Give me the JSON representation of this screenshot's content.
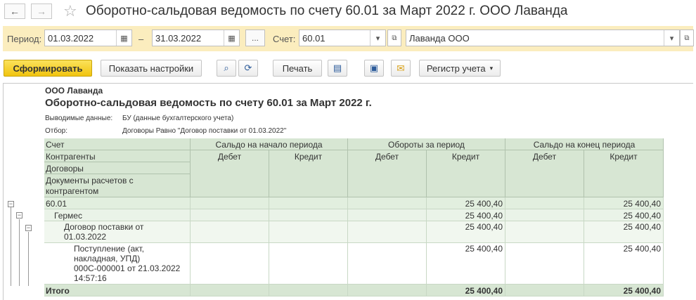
{
  "window": {
    "title": "Оборотно-сальдовая ведомость по счету 60.01 за Март 2022 г. ООО Лаванда",
    "back_icon": "←",
    "forward_icon": "→",
    "star_icon": "☆"
  },
  "params": {
    "period_label": "Период:",
    "period_from": "01.03.2022",
    "dash": "–",
    "period_to": "31.03.2022",
    "dots_label": "...",
    "account_label": "Счет:",
    "account_value": "60.01",
    "organization_value": "Лаванда ООО"
  },
  "toolbar": {
    "generate_label": "Сформировать",
    "settings_label": "Показать настройки",
    "print_label": "Печать",
    "register_label": "Регистр учета"
  },
  "report": {
    "org": "ООО Лаванда",
    "title": "Оборотно-сальдовая ведомость по счету 60.01 за Март 2022 г.",
    "output_label": "Выводимые данные:",
    "output_value": "БУ (данные бухгалтерского учета)",
    "filter_label": "Отбор:",
    "filter_value": "Договоры Равно \"Договор поставки от 01.03.2022\"",
    "headers": {
      "account": "Счет",
      "counterparties": "Контрагенты",
      "contracts": "Договоры",
      "documents_line1": "Документы расчетов с",
      "documents_line2": "контрагентом",
      "opening": "Сальдо на начало периода",
      "turnover": "Обороты за период",
      "closing": "Сальдо на конец периода",
      "debit": "Дебет",
      "credit": "Кредит"
    },
    "rows": {
      "account": {
        "name": "60.01",
        "turnover_credit": "25 400,40",
        "closing_credit": "25 400,40"
      },
      "counterparty": {
        "name": "Гермес",
        "turnover_credit": "25 400,40",
        "closing_credit": "25 400,40"
      },
      "contract": {
        "name_line1": "Договор поставки от",
        "name_line2": "01.03.2022",
        "turnover_credit": "25 400,40",
        "closing_credit": "25 400,40"
      },
      "document": {
        "line1": "Поступление (акт,",
        "line2": "накладная, УПД)",
        "line3": "000С-000001 от 21.03.2022",
        "line4": "14:57:16",
        "turnover_credit": "25 400,40",
        "closing_credit": "25 400,40"
      },
      "total": {
        "name": "Итого",
        "turnover_credit": "25 400,40",
        "closing_credit": "25 400,40"
      }
    }
  }
}
